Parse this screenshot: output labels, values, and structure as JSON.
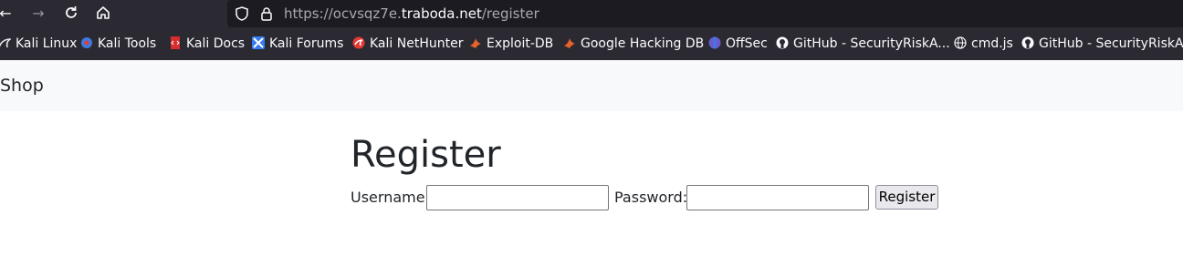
{
  "browser": {
    "url": {
      "prefix": "https://ocvsqz7e.",
      "host": "traboda.net",
      "path": "/register"
    },
    "bookmarks": [
      {
        "label": "Kali Linux",
        "icon": "kali-dragon-icon",
        "color": "#e8e8ee"
      },
      {
        "label": "Kali Tools",
        "icon": "kali-tools-icon",
        "color": "#3d7be0"
      },
      {
        "label": "Kali Docs",
        "icon": "kali-docs-icon",
        "color": "#d92d2d"
      },
      {
        "label": "Kali Forums",
        "icon": "kali-forums-icon",
        "color": "#367bf0"
      },
      {
        "label": "Kali NetHunter",
        "icon": "kali-nethunter-icon",
        "color": "#e53935"
      },
      {
        "label": "Exploit-DB",
        "icon": "exploit-db-icon",
        "color": "#e8632a"
      },
      {
        "label": "Google Hacking DB",
        "icon": "ghdb-icon",
        "color": "#e8632a"
      },
      {
        "label": "OffSec",
        "icon": "offsec-icon",
        "color": "#6a5acd"
      },
      {
        "label": "GitHub - SecurityRiskA...",
        "icon": "github-icon",
        "color": "#fbfbfe"
      },
      {
        "label": "cmd.js",
        "icon": "globe-icon",
        "color": "#fbfbfe"
      },
      {
        "label": "GitHub - SecurityRiskA...",
        "icon": "github-icon",
        "color": "#fbfbfe"
      }
    ]
  },
  "navbar": {
    "brand": "Shop"
  },
  "form": {
    "title": "Register",
    "username_label": "Username:",
    "username_value": "",
    "password_label": "Password:",
    "password_value": "",
    "submit_label": "Register"
  }
}
